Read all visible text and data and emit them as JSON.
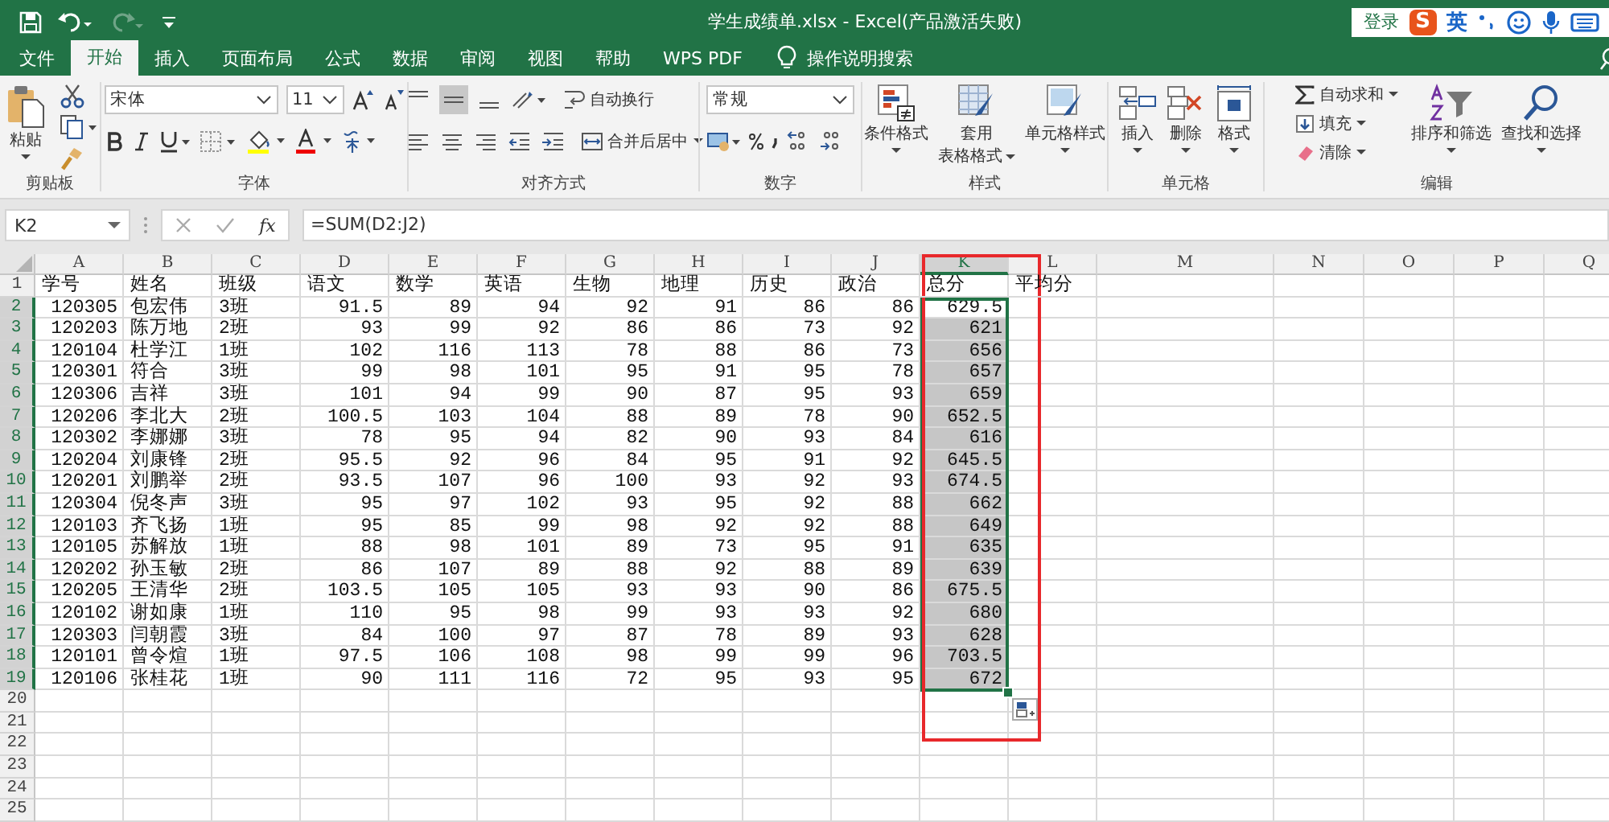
{
  "title_bar": {
    "title": "学生成绩单.xlsx  -  Excel(产品激活失败)",
    "redo_disabled": true
  },
  "ime_bar": {
    "login": "登录",
    "logo": "S",
    "mode": "英"
  },
  "tabs": [
    {
      "label": "文件",
      "selected": false
    },
    {
      "label": "开始",
      "selected": true
    },
    {
      "label": "插入",
      "selected": false
    },
    {
      "label": "页面布局",
      "selected": false
    },
    {
      "label": "公式",
      "selected": false
    },
    {
      "label": "数据",
      "selected": false
    },
    {
      "label": "审阅",
      "selected": false
    },
    {
      "label": "视图",
      "selected": false
    },
    {
      "label": "帮助",
      "selected": false
    },
    {
      "label": "WPS PDF",
      "selected": false
    }
  ],
  "tell_me": {
    "placeholder": "操作说明搜索"
  },
  "ribbon": {
    "clipboard": {
      "title": "剪贴板",
      "paste": "粘贴"
    },
    "font": {
      "title": "字体",
      "font_name": "宋体",
      "font_size": "11"
    },
    "alignment": {
      "title": "对齐方式",
      "wrap_text": "自动换行",
      "merge_center": "合并后居中",
      "middle_selected": true
    },
    "number": {
      "title": "数字",
      "format": "常规"
    },
    "styles": {
      "title": "样式",
      "buttons": [
        {
          "lines": [
            "条件格式"
          ]
        },
        {
          "lines": [
            "套用",
            "表格格式"
          ]
        },
        {
          "lines": [
            "单元格样式"
          ]
        }
      ]
    },
    "cells": {
      "title": "单元格",
      "buttons": [
        "插入",
        "删除",
        "格式"
      ]
    },
    "editing": {
      "title": "编辑",
      "autosum": "自动求和",
      "fill": "填充",
      "clear": "清除",
      "sort": "排序和筛选",
      "find": "查找和选择"
    }
  },
  "formula_bar": {
    "name_box": "K2",
    "fx": "fx",
    "formula": "=SUM(D2:J2)"
  },
  "sheet": {
    "columns": [
      {
        "label": "A",
        "selected": false
      },
      {
        "label": "B",
        "selected": false
      },
      {
        "label": "C",
        "selected": false
      },
      {
        "label": "D",
        "selected": false
      },
      {
        "label": "E",
        "selected": false
      },
      {
        "label": "F",
        "selected": false
      },
      {
        "label": "G",
        "selected": false
      },
      {
        "label": "H",
        "selected": false
      },
      {
        "label": "I",
        "selected": false
      },
      {
        "label": "J",
        "selected": false
      },
      {
        "label": "K",
        "selected": true
      },
      {
        "label": "L",
        "selected": false
      },
      {
        "label": "M",
        "selected": false
      },
      {
        "label": "N",
        "selected": false
      },
      {
        "label": "O",
        "selected": false
      },
      {
        "label": "P",
        "selected": false
      },
      {
        "label": "Q",
        "selected": false
      }
    ],
    "rows": [
      {
        "number": "1",
        "selected": false,
        "active": false,
        "cells": [
          "学号",
          "姓名",
          "班级",
          "语文",
          "数学",
          "英语",
          "生物",
          "地理",
          "历史",
          "政治",
          "总分",
          "平均分"
        ]
      },
      {
        "number": "2",
        "selected": true,
        "active": true,
        "cells": [
          "120305",
          "包宏伟",
          "3班",
          "91.5",
          "89",
          "94",
          "92",
          "91",
          "86",
          "86",
          "629.5"
        ]
      },
      {
        "number": "3",
        "selected": true,
        "active": false,
        "cells": [
          "120203",
          "陈万地",
          "2班",
          "93",
          "99",
          "92",
          "86",
          "86",
          "73",
          "92",
          "621"
        ]
      },
      {
        "number": "4",
        "selected": true,
        "active": false,
        "cells": [
          "120104",
          "杜学江",
          "1班",
          "102",
          "116",
          "113",
          "78",
          "88",
          "86",
          "73",
          "656"
        ]
      },
      {
        "number": "5",
        "selected": true,
        "active": false,
        "cells": [
          "120301",
          "符合",
          "3班",
          "99",
          "98",
          "101",
          "95",
          "91",
          "95",
          "78",
          "657"
        ]
      },
      {
        "number": "6",
        "selected": true,
        "active": false,
        "cells": [
          "120306",
          "吉祥",
          "3班",
          "101",
          "94",
          "99",
          "90",
          "87",
          "95",
          "93",
          "659"
        ]
      },
      {
        "number": "7",
        "selected": true,
        "active": false,
        "cells": [
          "120206",
          "李北大",
          "2班",
          "100.5",
          "103",
          "104",
          "88",
          "89",
          "78",
          "90",
          "652.5"
        ]
      },
      {
        "number": "8",
        "selected": true,
        "active": false,
        "cells": [
          "120302",
          "李娜娜",
          "3班",
          "78",
          "95",
          "94",
          "82",
          "90",
          "93",
          "84",
          "616"
        ]
      },
      {
        "number": "9",
        "selected": true,
        "active": false,
        "cells": [
          "120204",
          "刘康锋",
          "2班",
          "95.5",
          "92",
          "96",
          "84",
          "95",
          "91",
          "92",
          "645.5"
        ]
      },
      {
        "number": "10",
        "selected": true,
        "active": false,
        "cells": [
          "120201",
          "刘鹏举",
          "2班",
          "93.5",
          "107",
          "96",
          "100",
          "93",
          "92",
          "93",
          "674.5"
        ]
      },
      {
        "number": "11",
        "selected": true,
        "active": false,
        "cells": [
          "120304",
          "倪冬声",
          "3班",
          "95",
          "97",
          "102",
          "93",
          "95",
          "92",
          "88",
          "662"
        ]
      },
      {
        "number": "12",
        "selected": true,
        "active": false,
        "cells": [
          "120103",
          "齐飞扬",
          "1班",
          "95",
          "85",
          "99",
          "98",
          "92",
          "92",
          "88",
          "649"
        ]
      },
      {
        "number": "13",
        "selected": true,
        "active": false,
        "cells": [
          "120105",
          "苏解放",
          "1班",
          "88",
          "98",
          "101",
          "89",
          "73",
          "95",
          "91",
          "635"
        ]
      },
      {
        "number": "14",
        "selected": true,
        "active": false,
        "cells": [
          "120202",
          "孙玉敏",
          "2班",
          "86",
          "107",
          "89",
          "88",
          "92",
          "88",
          "89",
          "639"
        ]
      },
      {
        "number": "15",
        "selected": true,
        "active": false,
        "cells": [
          "120205",
          "王清华",
          "2班",
          "103.5",
          "105",
          "105",
          "93",
          "93",
          "90",
          "86",
          "675.5"
        ]
      },
      {
        "number": "16",
        "selected": true,
        "active": false,
        "cells": [
          "120102",
          "谢如康",
          "1班",
          "110",
          "95",
          "98",
          "99",
          "93",
          "93",
          "92",
          "680"
        ]
      },
      {
        "number": "17",
        "selected": true,
        "active": false,
        "cells": [
          "120303",
          "闫朝霞",
          "3班",
          "84",
          "100",
          "97",
          "87",
          "78",
          "89",
          "93",
          "628"
        ]
      },
      {
        "number": "18",
        "selected": true,
        "active": false,
        "cells": [
          "120101",
          "曾令煊",
          "1班",
          "97.5",
          "106",
          "108",
          "98",
          "99",
          "99",
          "96",
          "703.5"
        ]
      },
      {
        "number": "19",
        "selected": true,
        "active": false,
        "cells": [
          "120106",
          "张桂花",
          "1班",
          "90",
          "111",
          "116",
          "72",
          "95",
          "93",
          "95",
          "672"
        ]
      },
      {
        "number": "20",
        "selected": false,
        "active": false
      },
      {
        "number": "21",
        "selected": false,
        "active": false
      },
      {
        "number": "22",
        "selected": false,
        "active": false
      },
      {
        "number": "23",
        "selected": false,
        "active": false
      },
      {
        "number": "24",
        "selected": false,
        "active": false
      },
      {
        "number": "25",
        "selected": false,
        "active": false
      }
    ]
  }
}
